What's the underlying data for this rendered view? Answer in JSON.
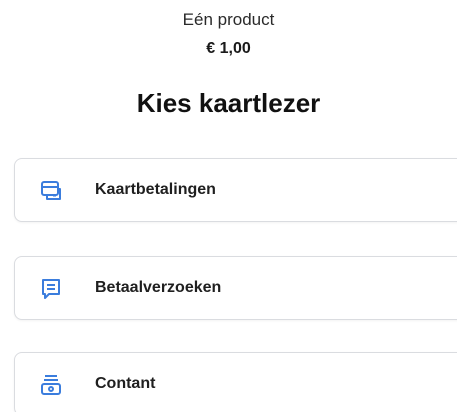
{
  "product": {
    "name": "Eén product",
    "price": "€ 1,00"
  },
  "title": "Kies kaartlezer",
  "options": [
    {
      "label": "Kaartbetalingen",
      "icon": "card-icon"
    },
    {
      "label": "Betaalverzoeken",
      "icon": "message-icon"
    },
    {
      "label": "Contant",
      "icon": "cash-register-icon"
    }
  ],
  "colors": {
    "accent": "#3b7ddd",
    "border": "#dadce0",
    "text": "#1f1f1f"
  }
}
